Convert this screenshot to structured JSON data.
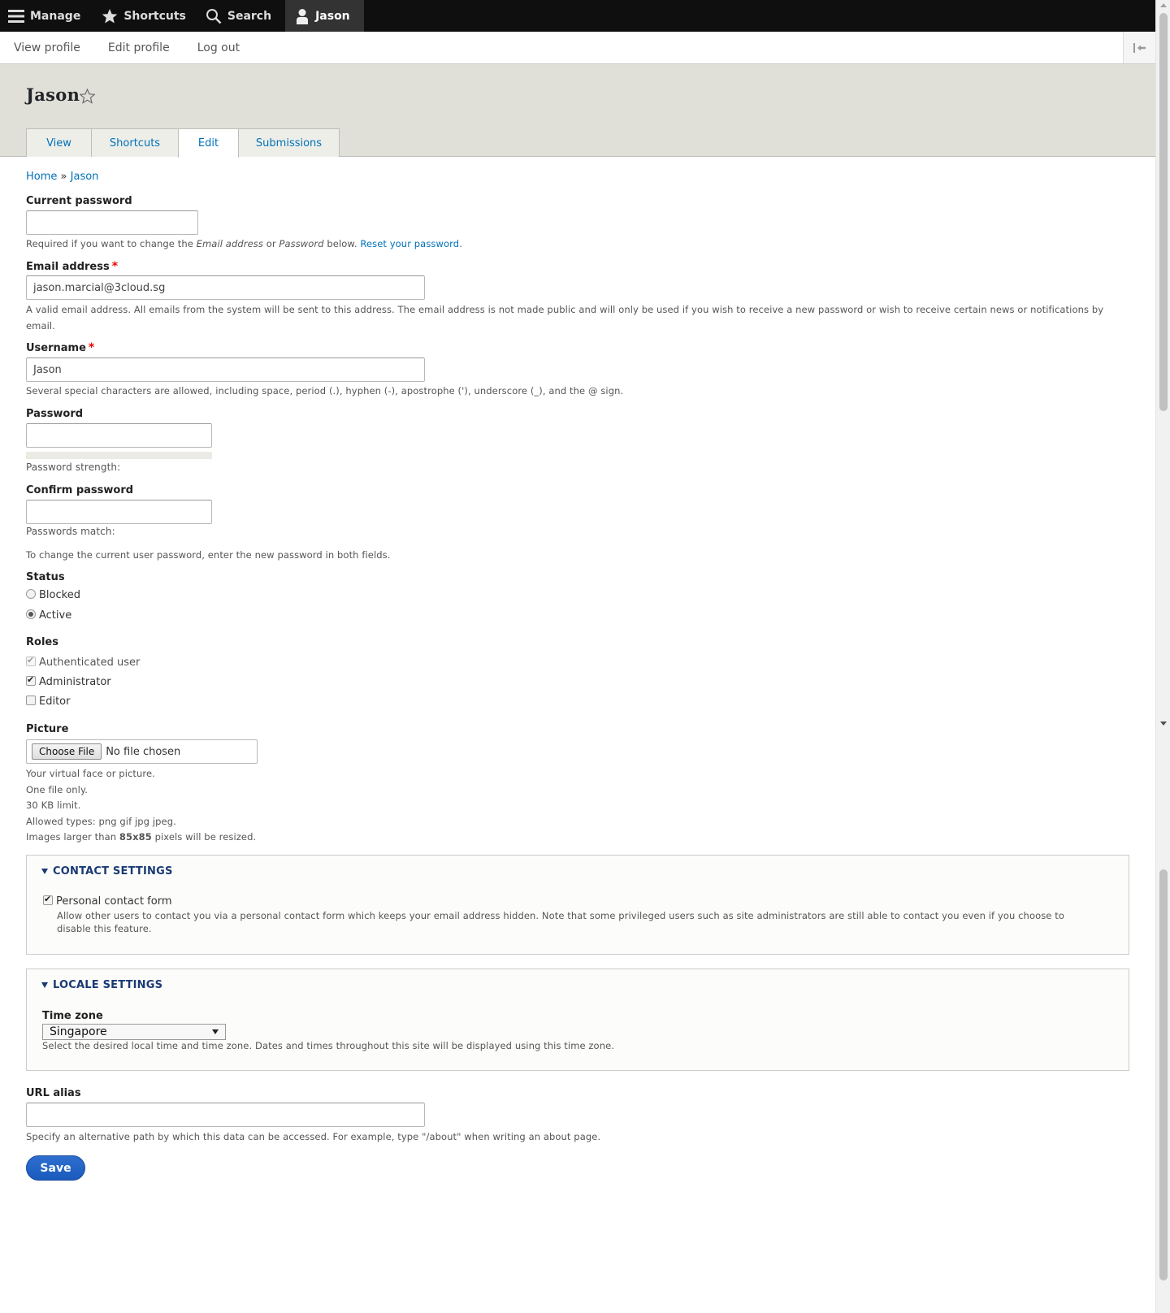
{
  "toolbar": {
    "manage": "Manage",
    "shortcuts": "Shortcuts",
    "search": "Search",
    "user": "Jason"
  },
  "tray": {
    "view_profile": "View profile",
    "edit_profile": "Edit profile",
    "log_out": "Log out"
  },
  "header": {
    "title": "Jason",
    "tabs": [
      "View",
      "Shortcuts",
      "Edit",
      "Submissions"
    ],
    "active_tab": "Edit"
  },
  "breadcrumb": {
    "home": "Home",
    "separator": "»",
    "current": "Jason"
  },
  "form": {
    "current_password": {
      "label": "Current password",
      "value": "",
      "desc_prefix": "Required if you want to change the ",
      "desc_email": "Email address",
      "desc_or": " or ",
      "desc_password": "Password",
      "desc_below": " below. ",
      "desc_link": "Reset your password",
      "desc_end": "."
    },
    "email": {
      "label": "Email address",
      "required_mark": "*",
      "value": "jason.marcial@3cloud.sg",
      "desc_line1": "A valid email address. All emails from the system will be sent to this address. The email address is not made public and will only be used if you wish to receive a new password or wish to receive certain news or notifications by",
      "desc_line2": "email."
    },
    "username": {
      "label": "Username",
      "required_mark": "*",
      "value": "Jason",
      "desc": "Several special characters are allowed, including space, period (.), hyphen (-), apostrophe ('), underscore (_), and the @ sign."
    },
    "password": {
      "label": "Password",
      "strength_label": "Password strength:",
      "strength_fill": 0
    },
    "confirm_password": {
      "label": "Confirm password",
      "match_label": "Passwords match:",
      "desc": "To change the current user password, enter the new password in both fields."
    },
    "status": {
      "label": "Status",
      "options": [
        "Blocked",
        "Active"
      ],
      "selected": "Active"
    },
    "roles": {
      "label": "Roles",
      "options": [
        {
          "label": "Authenticated user",
          "checked": true,
          "disabled": true
        },
        {
          "label": "Administrator",
          "checked": true,
          "disabled": false
        },
        {
          "label": "Editor",
          "checked": false,
          "disabled": false
        }
      ]
    },
    "picture": {
      "label": "Picture",
      "button": "Choose File",
      "no_file": "No file chosen",
      "desc1": "Your virtual face or picture.",
      "desc2": "One file only.",
      "desc3": "30 KB limit.",
      "desc4": "Allowed types: png gif jpg jpeg.",
      "desc5_prefix": "Images larger than ",
      "desc5_bold": "85x85",
      "desc5_suffix": " pixels will be resized."
    },
    "contact": {
      "legend": "CONTACT SETTINGS",
      "checkbox_label": "Personal contact form",
      "checked": true,
      "desc_line1": "Allow other users to contact you via a personal contact form which keeps your email address hidden. Note that some privileged users such as site administrators are still able to contact you even if you choose to",
      "desc_line2": "disable this feature."
    },
    "locale": {
      "legend": "LOCALE SETTINGS",
      "timezone_label": "Time zone",
      "timezone_value": "Singapore",
      "desc": "Select the desired local time and time zone. Dates and times throughout this site will be displayed using this time zone."
    },
    "url_alias": {
      "label": "URL alias",
      "value": "",
      "desc": "Specify an alternative path by which this data can be accessed. For example, type \"/about\" when writing an about page."
    },
    "save_label": "Save"
  },
  "colors": {
    "toolbar_bg": "#0f0f0f",
    "header_bg": "#e0e0d8",
    "link": "#0071b8",
    "legend": "#1a3a74",
    "save_button": "#1a5bbd"
  }
}
